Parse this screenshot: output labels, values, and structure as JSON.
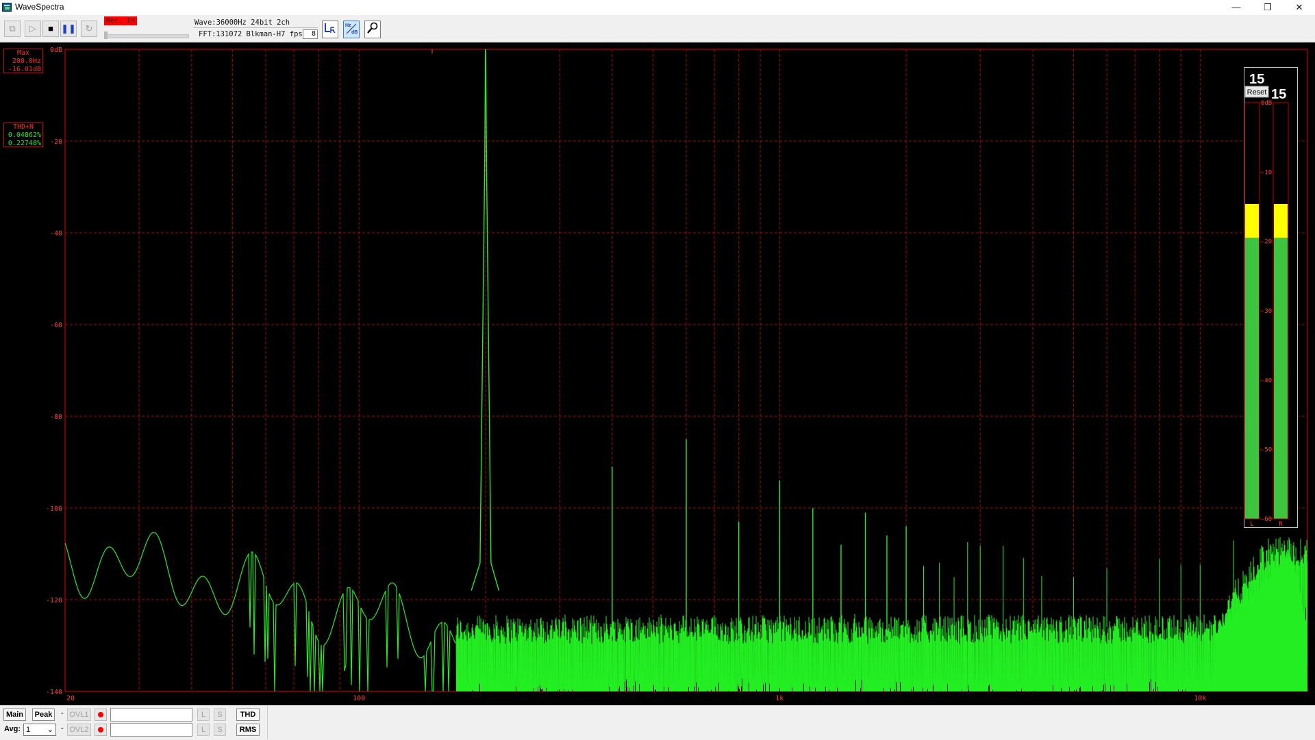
{
  "window": {
    "title": "WaveSpectra",
    "controls": {
      "minimize": "—",
      "restore": "❐",
      "close": "✕"
    }
  },
  "toolbar": {
    "rec_in_label": "Rec. In",
    "wave_info": "Wave:36000Hz 24bit 2ch",
    "fft_info": "FFT:131072 Blkman-H7 fps:",
    "fps_value": "8",
    "icons": [
      "copy-icon",
      "play-icon",
      "stop-icon",
      "pause-icon",
      "loop-icon",
      "lr-channel-icon",
      "hz-db-scale-icon",
      "settings-wrench-icon"
    ],
    "lr_button_label": "L₨",
    "scale_button_label": "Hz∕dB"
  },
  "readouts": {
    "max": {
      "title": "Max",
      "freq": "200.0Hz",
      "level": "-16.01dB"
    },
    "thd": {
      "title": "THD+N",
      "value1": "0.04862%",
      "value2": "0.22748%"
    }
  },
  "spectrum": {
    "y_labels": [
      "0dB",
      "-20",
      "-40",
      "-60",
      "-80",
      "-100",
      "-120",
      "-140"
    ],
    "x_labels": [
      "20",
      "100",
      "1k",
      "10k"
    ],
    "colors": {
      "trace": "#22ee22",
      "grid": "#b40000",
      "axis_text": "#ff4040",
      "background": "#000000"
    }
  },
  "chart_data": {
    "type": "line",
    "title": "",
    "xlabel": "",
    "ylabel": "",
    "x_scale": "log",
    "xlim": [
      20,
      18000
    ],
    "ylim": [
      -140,
      0
    ],
    "grid": true,
    "x_ticks": [
      20,
      100,
      1000,
      10000
    ],
    "x_tick_labels": [
      "20",
      "100",
      "1k",
      "10k"
    ],
    "y_ticks": [
      0,
      -20,
      -40,
      -60,
      -80,
      -100,
      -120,
      -140
    ],
    "y_tick_labels": [
      "0dB",
      "-20",
      "-40",
      "-60",
      "-80",
      "-100",
      "-120",
      "-140"
    ],
    "series": [
      {
        "peaks": [
          {
            "x": 200,
            "y": -16
          },
          {
            "x": 400,
            "y": -91
          },
          {
            "x": 600,
            "y": -85
          },
          {
            "x": 800,
            "y": -103
          },
          {
            "x": 1000,
            "y": -94
          },
          {
            "x": 1200,
            "y": -100
          },
          {
            "x": 1400,
            "y": -108
          },
          {
            "x": 1600,
            "y": -101
          },
          {
            "x": 1800,
            "y": -106
          },
          {
            "x": 2000,
            "y": -104
          }
        ]
      }
    ]
  },
  "meter": {
    "peak_hold_left": "15",
    "peak_hold_right": "15",
    "reset_label": "Reset",
    "scale": [
      "0dB",
      "-10",
      "-20",
      "-30",
      "-40",
      "-50",
      "-60"
    ],
    "channel_labels": [
      "L",
      "R"
    ],
    "level_left_db": -19.5,
    "level_right_db": -19.5,
    "peak_left_db": -14.6,
    "peak_right_db": -14.6
  },
  "bottom": {
    "main_label": "Main",
    "peak_label": "Peak",
    "ovl1_label": "OVL1",
    "ovl2_label": "OVL2",
    "l_label": "L",
    "s_label": "S",
    "thd_label": "THD",
    "rms_label": "RMS",
    "avg_label": "Avg:",
    "avg_value": "1",
    "dash": "-"
  }
}
